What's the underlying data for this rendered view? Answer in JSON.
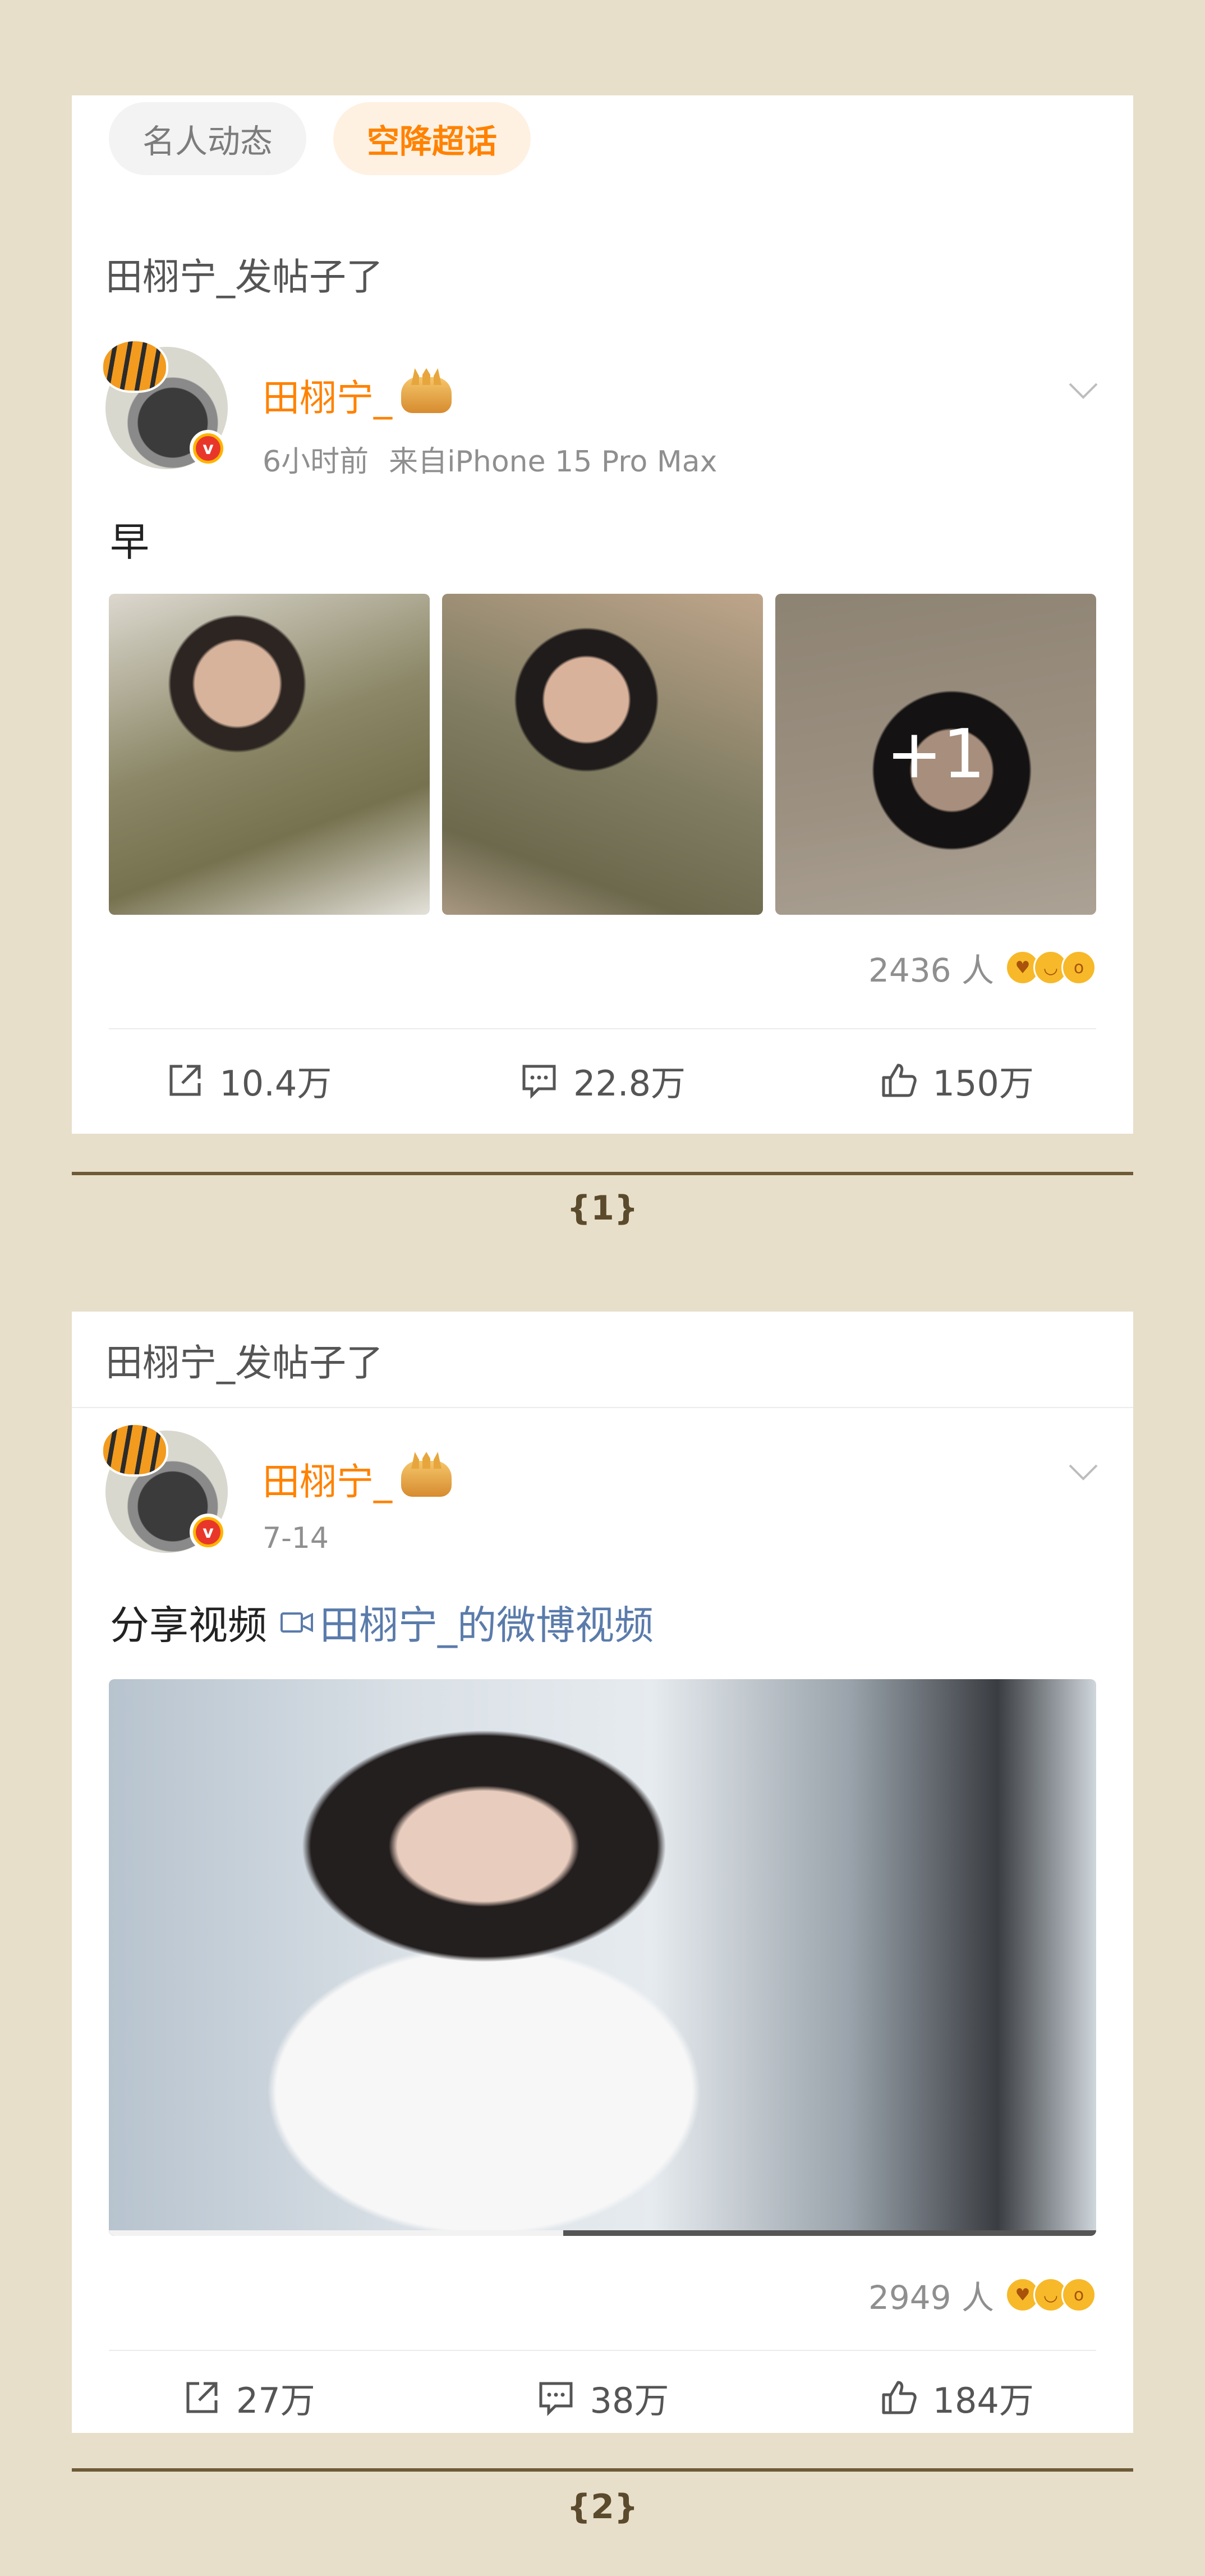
{
  "tabs": [
    {
      "label": "名人动态",
      "active": false
    },
    {
      "label": "空降超话",
      "active": true
    }
  ],
  "posts": [
    {
      "header": "田栩宁_发帖子了",
      "author": "田栩宁_",
      "time": "6小时前",
      "source": "来自iPhone 15 Pro Max",
      "text": "早",
      "image_more": "+1",
      "reaction_count": "2436 人",
      "repost": "10.4万",
      "comment": "22.8万",
      "like": "150万"
    },
    {
      "header": "田栩宁_发帖子了",
      "author": "田栩宁_",
      "time": "7-14",
      "text": "分享视频",
      "video_link": "田栩宁_的微博视频",
      "reaction_count": "2949 人",
      "repost": "27万",
      "comment": "38万",
      "like": "184万"
    }
  ],
  "pages": [
    "{1}",
    "{2}"
  ],
  "colors": {
    "accent": "#ff8200",
    "background": "#e7dfca",
    "link": "#5a7bab",
    "ribbon": "#6e5a37"
  },
  "icons": [
    "chevron-down-icon",
    "repost-icon",
    "comment-icon",
    "like-icon",
    "video-icon",
    "verified-badge-icon",
    "crown-icon"
  ]
}
